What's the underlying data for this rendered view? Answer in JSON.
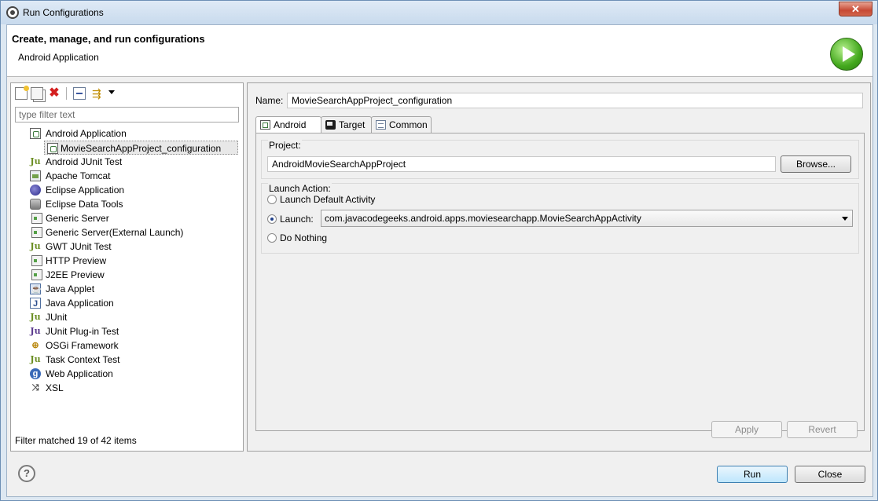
{
  "window": {
    "title": "Run Configurations",
    "close_glyph": "✕"
  },
  "header": {
    "title": "Create, manage, and run configurations",
    "subtitle": "Android Application"
  },
  "left": {
    "filter_placeholder": "type filter text",
    "tree": [
      {
        "label": "Android Application",
        "icon": "android-app-icon",
        "level": 0
      },
      {
        "label": "MovieSearchAppProject_configuration",
        "icon": "android-app-icon",
        "level": 1,
        "selected": true
      },
      {
        "label": "Android JUnit Test",
        "icon": "junit-icon",
        "level": 0
      },
      {
        "label": "Apache Tomcat",
        "icon": "tomcat-icon",
        "level": 0
      },
      {
        "label": "Eclipse Application",
        "icon": "eclipse-icon",
        "level": 0
      },
      {
        "label": "Eclipse Data Tools",
        "icon": "database-icon",
        "level": 0
      },
      {
        "label": "Generic Server",
        "icon": "server-icon",
        "level": 0
      },
      {
        "label": "Generic Server(External Launch)",
        "icon": "server-icon",
        "level": 0
      },
      {
        "label": "GWT JUnit Test",
        "icon": "junit-icon",
        "level": 0
      },
      {
        "label": "HTTP Preview",
        "icon": "server-icon",
        "level": 0
      },
      {
        "label": "J2EE Preview",
        "icon": "server-icon",
        "level": 0
      },
      {
        "label": "Java Applet",
        "icon": "java-applet-icon",
        "level": 0
      },
      {
        "label": "Java Application",
        "icon": "java-app-icon",
        "level": 0
      },
      {
        "label": "JUnit",
        "icon": "junit-icon",
        "level": 0
      },
      {
        "label": "JUnit Plug-in Test",
        "icon": "junit-icon",
        "level": 0
      },
      {
        "label": "OSGi Framework",
        "icon": "osgi-icon",
        "level": 0
      },
      {
        "label": "Task Context Test",
        "icon": "junit-icon",
        "level": 0
      },
      {
        "label": "Web Application",
        "icon": "web-app-icon",
        "level": 0
      },
      {
        "label": "XSL",
        "icon": "xsl-icon",
        "level": 0
      }
    ],
    "status": "Filter matched 19 of 42 items"
  },
  "right": {
    "name_label": "Name:",
    "name_value": "MovieSearchAppProject_configuration",
    "tabs": [
      {
        "label": "Android",
        "active": true
      },
      {
        "label": "Target",
        "active": false
      },
      {
        "label": "Common",
        "active": false
      }
    ],
    "project": {
      "label": "Project:",
      "value": "AndroidMovieSearchAppProject",
      "browse": "Browse..."
    },
    "launch_action": {
      "label": "Launch Action:",
      "options": [
        "Launch Default Activity",
        "Launch:",
        "Do Nothing"
      ],
      "selected": "Launch:",
      "activity": "com.javacodegeeks.android.apps.moviesearchapp.MovieSearchAppActivity"
    },
    "apply": "Apply",
    "revert": "Revert"
  },
  "footer": {
    "help": "?",
    "run": "Run",
    "close": "Close"
  }
}
